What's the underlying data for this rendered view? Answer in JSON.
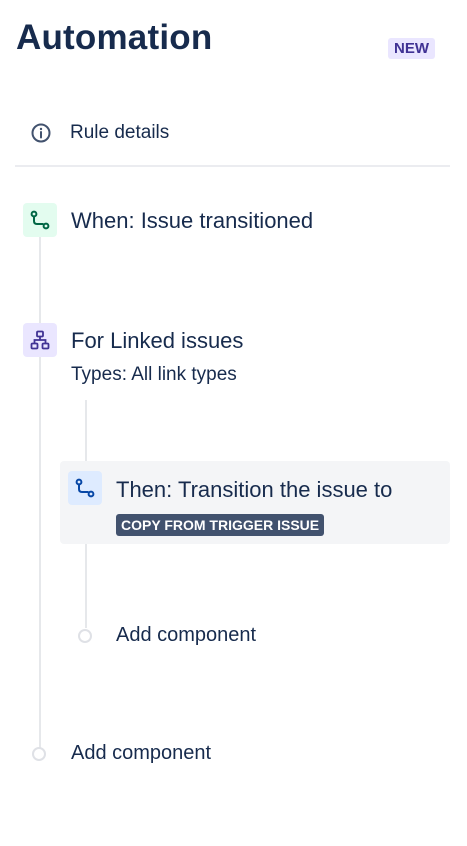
{
  "header": {
    "title": "Automation",
    "badge": "NEW"
  },
  "rule_details": {
    "label": "Rule details",
    "icon": "info-icon"
  },
  "trigger": {
    "label": "When: Issue transitioned",
    "icon": "transition-icon"
  },
  "branch": {
    "label": "For Linked issues",
    "subtitle": "Types: All link types",
    "icon": "branch-icon"
  },
  "action": {
    "label": "Then: Transition the issue to",
    "lozenge": "COPY FROM TRIGGER ISSUE",
    "icon": "transition-icon"
  },
  "add_component_inner": {
    "label": "Add component"
  },
  "add_component_outer": {
    "label": "Add component"
  },
  "colors": {
    "text": "#172b4d",
    "badge_bg": "#eae6ff",
    "badge_text": "#403294",
    "trigger_icon_bg": "#e3fcef",
    "trigger_icon_color": "#006644",
    "branch_icon_bg": "#eae6ff",
    "branch_icon_color": "#403294",
    "action_icon_bg": "#deebff",
    "action_icon_color": "#0747a6",
    "lozenge_bg": "#42526e",
    "card_bg": "#f4f5f7"
  }
}
